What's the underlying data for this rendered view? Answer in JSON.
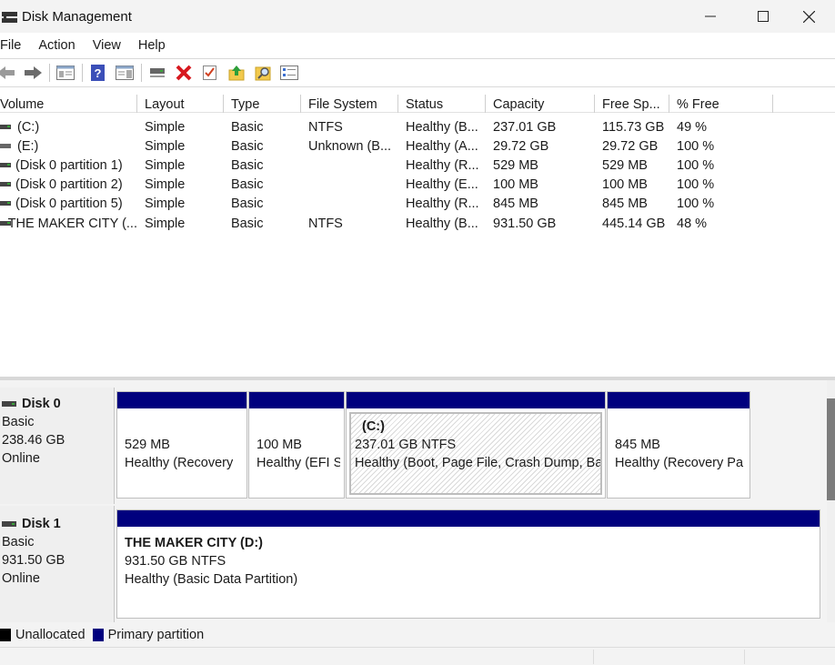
{
  "window": {
    "title": "Disk Management"
  },
  "menu": [
    "File",
    "Action",
    "View",
    "Help"
  ],
  "toolbar": {
    "icons": [
      "back-icon",
      "forward-icon",
      "show-hide-console-tree-icon",
      "help-icon",
      "properties-pane-icon",
      "connect-icon",
      "delete-icon",
      "check-icon",
      "import-icon",
      "search-icon",
      "list-icon"
    ]
  },
  "volume_list": {
    "columns": [
      "Volume",
      "Layout",
      "Type",
      "File System",
      "Status",
      "Capacity",
      "Free Sp...",
      "% Free"
    ],
    "rows": [
      [
        "(C:)",
        "Simple",
        "Basic",
        "NTFS",
        "Healthy (B...",
        "237.01 GB",
        "115.73 GB",
        "49 %"
      ],
      [
        "(E:)",
        "Simple",
        "Basic",
        "Unknown (B...",
        "Healthy (A...",
        "29.72 GB",
        "29.72 GB",
        "100 %"
      ],
      [
        "(Disk 0 partition 1)",
        "Simple",
        "Basic",
        "",
        "Healthy (R...",
        "529 MB",
        "529 MB",
        "100 %"
      ],
      [
        "(Disk 0 partition 2)",
        "Simple",
        "Basic",
        "",
        "Healthy (E...",
        "100 MB",
        "100 MB",
        "100 %"
      ],
      [
        "(Disk 0 partition 5)",
        "Simple",
        "Basic",
        "",
        "Healthy (R...",
        "845 MB",
        "845 MB",
        "100 %"
      ],
      [
        "THE MAKER CITY (...",
        "Simple",
        "Basic",
        "NTFS",
        "Healthy (B...",
        "931.50 GB",
        "445.14 GB",
        "48 %"
      ]
    ]
  },
  "disks": [
    {
      "name": "Disk 0",
      "type": "Basic",
      "size": "238.46 GB",
      "status": "Online",
      "partitions": [
        {
          "title": "",
          "size": "529 MB",
          "status": "Healthy (Recovery"
        },
        {
          "title": "",
          "size": "100 MB",
          "status": "Healthy (EFI S"
        },
        {
          "title": "(C:)",
          "size": "237.01 GB NTFS",
          "status": "Healthy (Boot, Page File, Crash Dump, Ba"
        },
        {
          "title": "",
          "size": "845 MB",
          "status": "Healthy (Recovery Pa"
        }
      ]
    },
    {
      "name": "Disk 1",
      "type": "Basic",
      "size": "931.50 GB",
      "status": "Online",
      "partitions": [
        {
          "title": "THE MAKER CITY  (D:)",
          "size": "931.50 GB NTFS",
          "status": "Healthy (Basic Data Partition)"
        }
      ]
    }
  ],
  "legend": {
    "unallocated": {
      "label": "Unallocated",
      "color": "#000000"
    },
    "primary": {
      "label": "Primary partition",
      "color": "#00007e"
    }
  }
}
